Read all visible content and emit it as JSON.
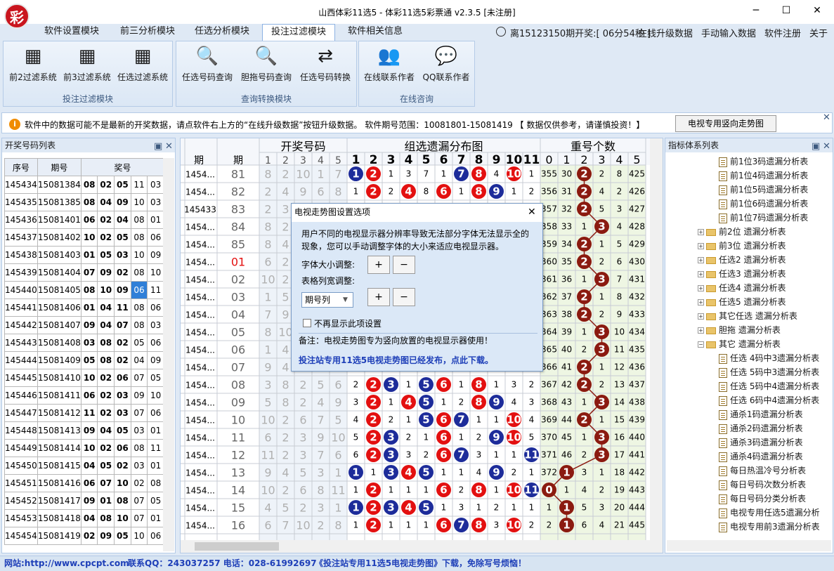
{
  "window": {
    "title": "山西体彩11选5 - 体彩11选5彩票通 v2.3.5 [未注册]",
    "logo": "彩",
    "minimize": "─",
    "maximize": "☐",
    "close": "✕"
  },
  "tabs": [
    "软件设置模块",
    "前三分析模块",
    "任选分析模块",
    "投注过滤模块",
    "软件相关信息"
  ],
  "header_right": {
    "countdown": "离15123150期开奖:[ 06分54秒 ]",
    "links": [
      "在线升级数据",
      "手动输入数据",
      "软件注册",
      "关于"
    ]
  },
  "ribbon": {
    "groups": [
      {
        "title": "投注过滤模块",
        "buttons": [
          "前2过滤系统",
          "前3过滤系统",
          "任选过滤系统"
        ]
      },
      {
        "title": "查询转换模块",
        "buttons": [
          "任选号码查询",
          "胆拖号码查询",
          "任选号码转换"
        ]
      },
      {
        "title": "在线咨询",
        "buttons": [
          "在线联系作者",
          "QQ联系作者"
        ]
      }
    ]
  },
  "info": {
    "icon": "i",
    "text": "软件中的数据可能不是最新的开奖数据，请点软件右上方的“在线升级数据”按钮升级数据。 软件期号范围：10081801-15081419 【 数据仅供参考，请谨慎投资！】",
    "tv_button": "电视专用竖向走势图"
  },
  "left_panel": {
    "title": "开奖号码列表",
    "pin": "▣",
    "close": "✕",
    "headers": [
      "序号",
      "期号",
      "奖号"
    ],
    "rows": [
      [
        "145434",
        "15081384",
        "08",
        "02",
        "05",
        "11",
        "03"
      ],
      [
        "145435",
        "15081385",
        "08",
        "04",
        "09",
        "10",
        "03"
      ],
      [
        "145436",
        "15081401",
        "06",
        "02",
        "04",
        "08",
        "01"
      ],
      [
        "145437",
        "15081402",
        "10",
        "02",
        "05",
        "08",
        "06"
      ],
      [
        "145438",
        "15081403",
        "01",
        "05",
        "03",
        "10",
        "09"
      ],
      [
        "145439",
        "15081404",
        "07",
        "09",
        "02",
        "08",
        "10"
      ],
      [
        "145440",
        "15081405",
        "08",
        "10",
        "09",
        "06",
        "11"
      ],
      [
        "145441",
        "15081406",
        "01",
        "04",
        "11",
        "08",
        "06"
      ],
      [
        "145442",
        "15081407",
        "09",
        "04",
        "07",
        "08",
        "03"
      ],
      [
        "145443",
        "15081408",
        "03",
        "08",
        "02",
        "05",
        "06"
      ],
      [
        "145444",
        "15081409",
        "05",
        "08",
        "02",
        "04",
        "09"
      ],
      [
        "145445",
        "15081410",
        "10",
        "02",
        "06",
        "07",
        "05"
      ],
      [
        "145446",
        "15081411",
        "06",
        "02",
        "03",
        "09",
        "10"
      ],
      [
        "145447",
        "15081412",
        "11",
        "02",
        "03",
        "07",
        "06"
      ],
      [
        "145448",
        "15081413",
        "09",
        "04",
        "05",
        "03",
        "01"
      ],
      [
        "145449",
        "15081414",
        "10",
        "02",
        "06",
        "08",
        "11"
      ],
      [
        "145450",
        "15081415",
        "04",
        "05",
        "02",
        "03",
        "01"
      ],
      [
        "145451",
        "15081416",
        "06",
        "07",
        "10",
        "02",
        "08"
      ],
      [
        "145452",
        "15081417",
        "09",
        "01",
        "08",
        "07",
        "05"
      ],
      [
        "145453",
        "15081418",
        "04",
        "08",
        "10",
        "07",
        "01"
      ],
      [
        "145454",
        "15081419",
        "02",
        "09",
        "05",
        "10",
        "06"
      ]
    ]
  },
  "center": {
    "group_headers": [
      "开奖号码",
      "组选遗漏分布图",
      "重号个数"
    ],
    "col1": "期",
    "col2": "期",
    "sub1": [
      "1",
      "2",
      "3",
      "4",
      "5"
    ],
    "sub2": [
      "1",
      "2",
      "3",
      "4",
      "5",
      "6",
      "7",
      "8",
      "9",
      "10",
      "11"
    ],
    "sub3": [
      "0",
      "1",
      "2",
      "3",
      "4",
      "5"
    ],
    "rows": [
      {
        "id": "1454...",
        "period": "81",
        "draw": [
          "8",
          "2",
          "10",
          "1",
          "7"
        ],
        "miss": [
          "●",
          "●",
          "1",
          "3",
          "7",
          "1",
          "●",
          "●",
          "4",
          "●",
          "1"
        ],
        "rep": [
          "355",
          "30",
          "●",
          "2",
          "8",
          "425"
        ]
      },
      {
        "id": "1454...",
        "period": "82",
        "draw": [
          "2",
          "4",
          "9",
          "6",
          "8"
        ],
        "miss": [
          "1",
          "●",
          "2",
          "●",
          "8",
          "●",
          "1",
          "●",
          "●",
          "1",
          "2"
        ],
        "rep": [
          "356",
          "31",
          "●",
          "4",
          "2",
          "426"
        ]
      },
      {
        "id": "145433",
        "period": "83",
        "draw": [
          "2",
          "3",
          "",
          "",
          ""
        ],
        "miss": [],
        "rep": [
          "357",
          "32",
          "●",
          "5",
          "3",
          "427"
        ]
      },
      {
        "id": "1454...",
        "period": "84",
        "draw": [
          "8",
          "2",
          "",
          "",
          ""
        ],
        "miss": [],
        "rep": [
          "358",
          "33",
          "1",
          "●",
          "4",
          "428"
        ]
      },
      {
        "id": "1454...",
        "period": "85",
        "draw": [
          "8",
          "4",
          "",
          "",
          ""
        ],
        "miss": [],
        "rep": [
          "359",
          "34",
          "●",
          "1",
          "5",
          "429"
        ]
      },
      {
        "id": "1454...",
        "period": "01",
        "draw": [
          "6",
          "2",
          "",
          "",
          ""
        ],
        "miss": [],
        "rep": [
          "360",
          "35",
          "●",
          "2",
          "6",
          "430"
        ]
      },
      {
        "id": "1454...",
        "period": "02",
        "draw": [
          "10",
          "2",
          "",
          "",
          ""
        ],
        "miss": [],
        "rep": [
          "361",
          "36",
          "1",
          "●",
          "7",
          "431"
        ]
      },
      {
        "id": "1454...",
        "period": "03",
        "draw": [
          "1",
          "5",
          "",
          "",
          ""
        ],
        "miss": [],
        "rep": [
          "362",
          "37",
          "●",
          "1",
          "8",
          "432"
        ]
      },
      {
        "id": "1454...",
        "period": "04",
        "draw": [
          "7",
          "9",
          "",
          "",
          ""
        ],
        "miss": [],
        "rep": [
          "363",
          "38",
          "●",
          "2",
          "9",
          "433"
        ]
      },
      {
        "id": "1454...",
        "period": "05",
        "draw": [
          "8",
          "10",
          "",
          "",
          ""
        ],
        "miss": [],
        "rep": [
          "364",
          "39",
          "1",
          "●",
          "10",
          "434"
        ]
      },
      {
        "id": "1454...",
        "period": "06",
        "draw": [
          "1",
          "4",
          "",
          "",
          ""
        ],
        "miss": [],
        "rep": [
          "365",
          "40",
          "2",
          "●",
          "11",
          "435"
        ]
      },
      {
        "id": "1454...",
        "period": "07",
        "draw": [
          "9",
          "4",
          "",
          "",
          ""
        ],
        "miss": [],
        "rep": [
          "366",
          "41",
          "●",
          "1",
          "12",
          "436"
        ]
      },
      {
        "id": "1454...",
        "period": "08",
        "draw": [
          "3",
          "8",
          "2",
          "5",
          "6"
        ],
        "miss": [
          "2",
          "●",
          "●",
          "1",
          "●",
          "●",
          "1",
          "●",
          "1",
          "3",
          "2"
        ],
        "rep": [
          "367",
          "42",
          "●",
          "2",
          "13",
          "437"
        ]
      },
      {
        "id": "1454...",
        "period": "09",
        "draw": [
          "5",
          "8",
          "2",
          "4",
          "9"
        ],
        "miss": [
          "3",
          "●",
          "1",
          "●",
          "●",
          "1",
          "2",
          "●",
          "●",
          "4",
          "3"
        ],
        "rep": [
          "368",
          "43",
          "1",
          "●",
          "14",
          "438"
        ]
      },
      {
        "id": "1454...",
        "period": "10",
        "draw": [
          "10",
          "2",
          "6",
          "7",
          "5"
        ],
        "miss": [
          "4",
          "●",
          "2",
          "1",
          "●",
          "●",
          "●",
          "1",
          "1",
          "●",
          "4"
        ],
        "rep": [
          "369",
          "44",
          "●",
          "1",
          "15",
          "439"
        ]
      },
      {
        "id": "1454...",
        "period": "11",
        "draw": [
          "6",
          "2",
          "3",
          "9",
          "10"
        ],
        "miss": [
          "5",
          "●",
          "●",
          "2",
          "1",
          "●",
          "1",
          "2",
          "●",
          "●",
          "5"
        ],
        "rep": [
          "370",
          "45",
          "1",
          "●",
          "16",
          "440"
        ]
      },
      {
        "id": "1454...",
        "period": "12",
        "draw": [
          "11",
          "2",
          "3",
          "7",
          "6"
        ],
        "miss": [
          "6",
          "●",
          "●",
          "3",
          "2",
          "●",
          "●",
          "3",
          "1",
          "1",
          "●"
        ],
        "rep": [
          "371",
          "46",
          "2",
          "●",
          "17",
          "441"
        ]
      },
      {
        "id": "1454...",
        "period": "13",
        "draw": [
          "9",
          "4",
          "5",
          "3",
          "1"
        ],
        "miss": [
          "●",
          "1",
          "●",
          "●",
          "●",
          "1",
          "1",
          "4",
          "●",
          "2",
          "1"
        ],
        "rep": [
          "372",
          "●",
          "3",
          "1",
          "18",
          "442"
        ]
      },
      {
        "id": "1454...",
        "period": "14",
        "draw": [
          "10",
          "2",
          "6",
          "8",
          "11"
        ],
        "miss": [
          "1",
          "●",
          "1",
          "1",
          "1",
          "●",
          "2",
          "●",
          "1",
          "●",
          "●"
        ],
        "rep": [
          "●",
          "1",
          "4",
          "2",
          "19",
          "443"
        ]
      },
      {
        "id": "1454...",
        "period": "15",
        "draw": [
          "4",
          "5",
          "2",
          "3",
          "1"
        ],
        "miss": [
          "●",
          "●",
          "●",
          "●",
          "●",
          "1",
          "3",
          "1",
          "2",
          "1",
          "1"
        ],
        "rep": [
          "1",
          "●",
          "5",
          "3",
          "20",
          "444"
        ]
      },
      {
        "id": "1454...",
        "period": "16",
        "draw": [
          "6",
          "7",
          "10",
          "2",
          "8"
        ],
        "miss": [
          "1",
          "●",
          "1",
          "1",
          "1",
          "●",
          "●",
          "●",
          "3",
          "●",
          "2"
        ],
        "rep": [
          "2",
          "●",
          "6",
          "4",
          "21",
          "445"
        ]
      }
    ]
  },
  "right_panel": {
    "title": "指标体系列表",
    "pin": "▣",
    "close": "✕",
    "items": [
      {
        "t": "前1位3码遗漏分析表",
        "k": "doc"
      },
      {
        "t": "前1位4码遗漏分析表",
        "k": "doc"
      },
      {
        "t": "前1位5码遗漏分析表",
        "k": "doc"
      },
      {
        "t": "前1位6码遗漏分析表",
        "k": "doc"
      },
      {
        "t": "前1位7码遗漏分析表",
        "k": "doc"
      },
      {
        "t": "前2位 遗漏分析表",
        "k": "folder"
      },
      {
        "t": "前3位 遗漏分析表",
        "k": "folder"
      },
      {
        "t": "任选2 遗漏分析表",
        "k": "folder"
      },
      {
        "t": "任选3 遗漏分析表",
        "k": "folder"
      },
      {
        "t": "任选4 遗漏分析表",
        "k": "folder"
      },
      {
        "t": "任选5 遗漏分析表",
        "k": "folder"
      },
      {
        "t": "其它任选 遗漏分析表",
        "k": "folder"
      },
      {
        "t": "胆拖 遗漏分析表",
        "k": "folder"
      },
      {
        "t": "其它 遗漏分析表",
        "k": "folder-open"
      },
      {
        "t": "任选 4码中3遗漏分析表",
        "k": "doc"
      },
      {
        "t": "任选 5码中3遗漏分析表",
        "k": "doc"
      },
      {
        "t": "任选 5码中4遗漏分析表",
        "k": "doc"
      },
      {
        "t": "任选 6码中4遗漏分析表",
        "k": "doc"
      },
      {
        "t": "通杀1码遗漏分析表",
        "k": "doc"
      },
      {
        "t": "通杀2码遗漏分析表",
        "k": "doc"
      },
      {
        "t": "通杀3码遗漏分析表",
        "k": "doc"
      },
      {
        "t": "通杀4码遗漏分析表",
        "k": "doc"
      },
      {
        "t": "每日热温冷号分析表",
        "k": "doc"
      },
      {
        "t": "每日号码次数分析表",
        "k": "doc"
      },
      {
        "t": "每日号码分类分析表",
        "k": "doc"
      },
      {
        "t": "电视专用任选5遗漏分析",
        "k": "doc"
      },
      {
        "t": "电视专用前3遗漏分析表",
        "k": "doc"
      }
    ]
  },
  "dialog": {
    "title": "电视走势图设置选项",
    "close": "✕",
    "desc": "用户不同的电视显示器分辨率导致无法部分字体无法显示全的现象，您可以手动调整字体的大小来适应电视显示器。",
    "font_label": "字体大小调整:",
    "col_label": "表格列宽调整:",
    "plus": "+",
    "minus": "−",
    "select_value": "期号列",
    "checkbox_label": "不再显示此项设置",
    "note": "备注：电视走势图专为竖向放置的电视显示器使用！",
    "link": "投注站专用11选5电视走势图已经发布，点此下载。"
  },
  "statusbar": {
    "website": "网站:http://www.cpcpt.com",
    "contact": "联系QQ：243037257 电话：028-61992697",
    "promo": "《投注站专用11选5电视走势图》下载，免除写号烦恼！"
  },
  "colors": {
    "red": "#e31010",
    "blue": "#1d2c9a",
    "maroon": "#8b1a10",
    "accent_blue": "#1e3fb8",
    "selected": "#2f7fd8"
  }
}
